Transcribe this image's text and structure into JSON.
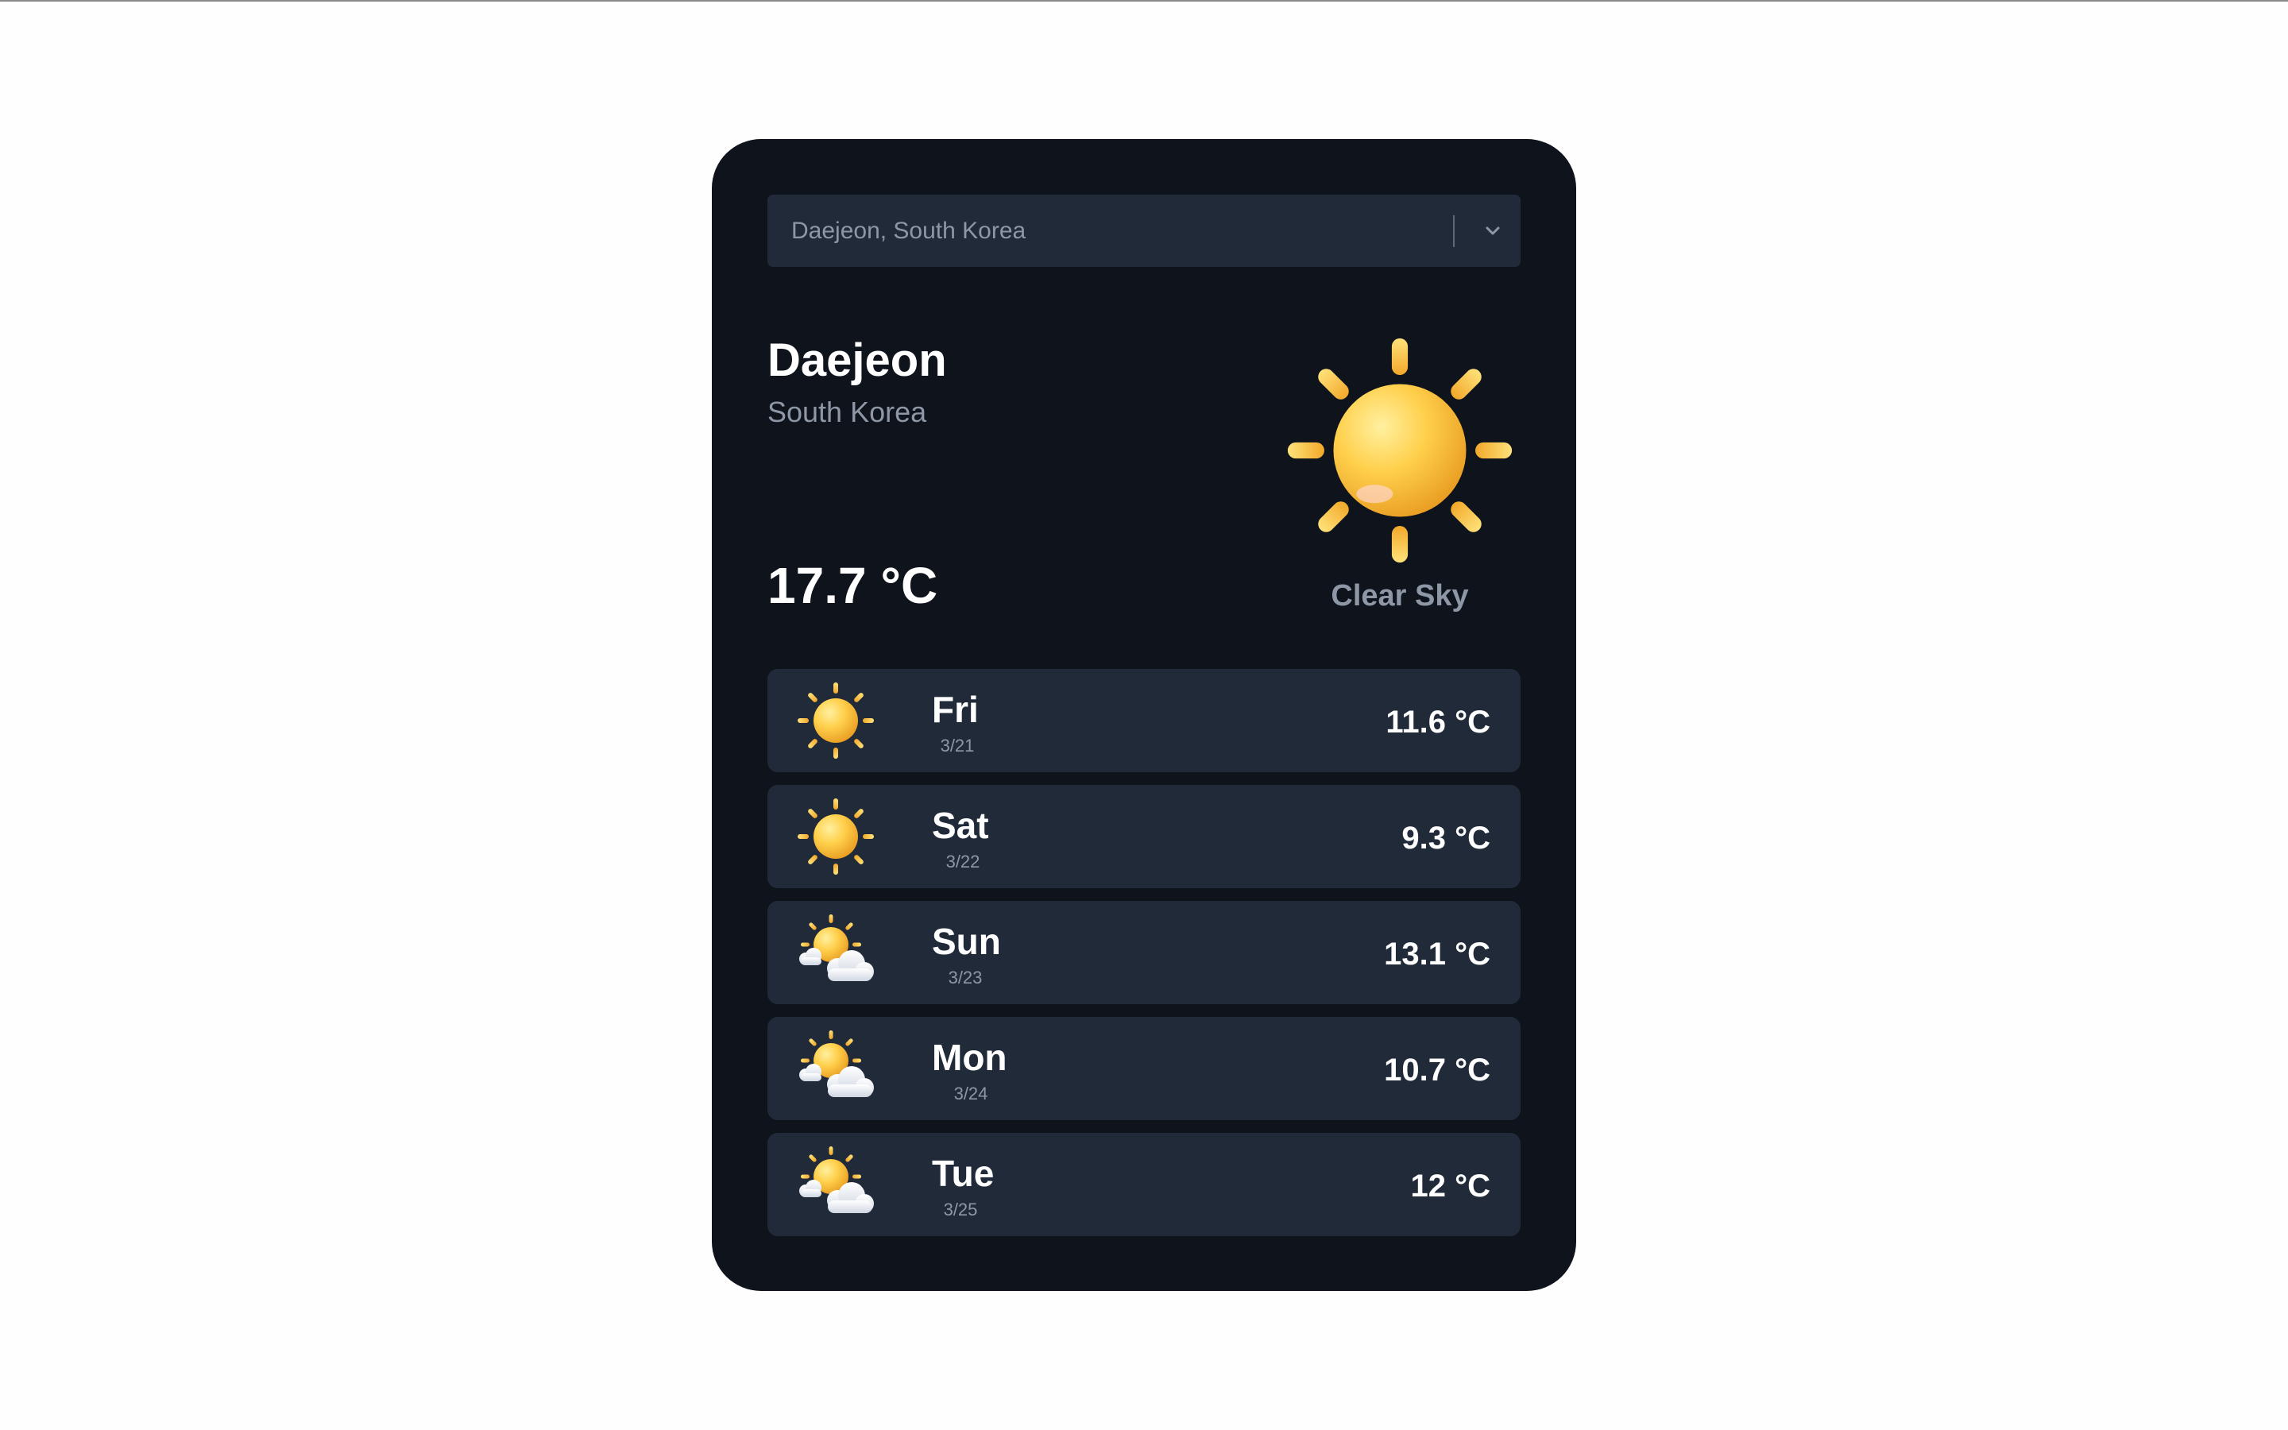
{
  "location_select": {
    "value": "Daejeon, South Korea",
    "chevron_icon": "chevron-down-icon"
  },
  "current": {
    "city": "Daejeon",
    "country": "South Korea",
    "temperature": "17.7 °C",
    "condition": "Clear Sky",
    "icon": "sun-icon"
  },
  "forecast": [
    {
      "day": "Fri",
      "date": "3/21",
      "temp": "11.6 °C",
      "icon": "sun-icon"
    },
    {
      "day": "Sat",
      "date": "3/22",
      "temp": "9.3 °C",
      "icon": "sun-icon"
    },
    {
      "day": "Sun",
      "date": "3/23",
      "temp": "13.1 °C",
      "icon": "partly-cloudy-icon"
    },
    {
      "day": "Mon",
      "date": "3/24",
      "temp": "10.7 °C",
      "icon": "partly-cloudy-icon"
    },
    {
      "day": "Tue",
      "date": "3/25",
      "temp": "12 °C",
      "icon": "partly-cloudy-icon"
    }
  ],
  "colors": {
    "page_background": "#fefefe",
    "card_background": "#0e131c",
    "row_background": "#212a39",
    "muted_text": "#8e97a6",
    "sun_yellow": "#f5bf33"
  }
}
